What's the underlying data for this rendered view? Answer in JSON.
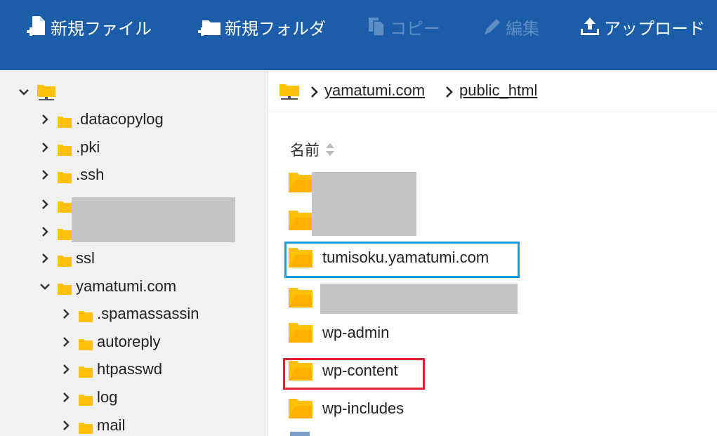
{
  "toolbar": {
    "new_file": "新規ファイル",
    "new_folder": "新規フォルダ",
    "copy": "コピー",
    "edit": "編集",
    "upload": "アップロード"
  },
  "sidebar": {
    "items": [
      {
        "label": ".datacopylog"
      },
      {
        "label": ".pki"
      },
      {
        "label": ".ssh"
      },
      {
        "label": "ssl"
      },
      {
        "label": "yamatumi.com"
      },
      {
        "label": ".spamassassin"
      },
      {
        "label": "autoreply"
      },
      {
        "label": "htpasswd"
      },
      {
        "label": "log"
      },
      {
        "label": "mail"
      }
    ]
  },
  "breadcrumb": {
    "items": [
      {
        "label": "yamatumi.com"
      },
      {
        "label": "public_html"
      }
    ]
  },
  "list": {
    "column_name": "名前",
    "rows": [
      {
        "label": "tumisoku.yamatumi.com"
      },
      {
        "label": "wp-admin"
      },
      {
        "label": "wp-content"
      },
      {
        "label": "wp-includes"
      }
    ]
  },
  "colors": {
    "toolbar_bg": "#1b5da8",
    "folder_yellow": "#ffc107",
    "highlight_blue": "#1a9fd9",
    "highlight_red": "#e0202f"
  },
  "icons": [
    "new-file-icon",
    "new-folder-icon",
    "copy-icon",
    "pencil-icon",
    "upload-icon",
    "folder-icon",
    "chevron-right-icon",
    "chevron-down-icon",
    "sort-icon"
  ]
}
